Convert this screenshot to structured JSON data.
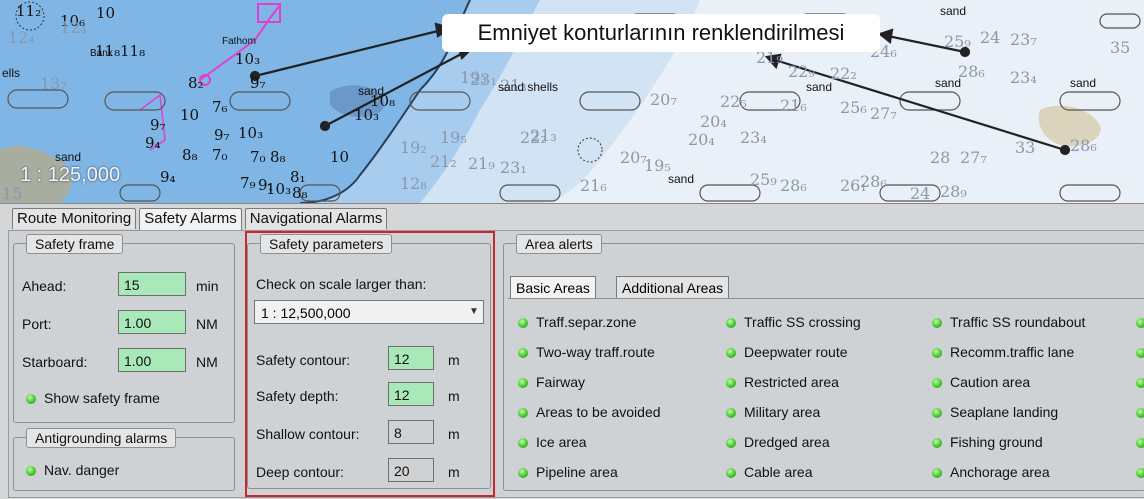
{
  "chart": {
    "callout_text": "Emniyet konturlarının renklendirilmesi",
    "scale": "1 : 125,000",
    "nature_labels": [
      "sand shells",
      "sand",
      "sand",
      "sand",
      "sand",
      "sand",
      "sand",
      "sand",
      "Bank",
      "Fathom",
      "ells"
    ],
    "depths_dark": [
      "11₂",
      "10₆",
      "11₈",
      "10",
      "8₂",
      "9₇",
      "10₃",
      "9₄",
      "8₈",
      "7₆",
      "7₀",
      "9₇",
      "10",
      "9₇",
      "10₃",
      "10₃",
      "8₈",
      "7₀",
      "9₄",
      "7₉",
      "9₁",
      "10₃",
      "8₁",
      "8₈",
      "10",
      "10₈",
      "11₈"
    ],
    "depths_light": [
      "19₃",
      "21₃",
      "23₁",
      "21₉",
      "22₉",
      "22₂",
      "24₆",
      "25₉",
      "24",
      "23₇",
      "35",
      "28₆",
      "23₄",
      "19₅",
      "21₃",
      "20₇",
      "20₄",
      "20₄",
      "23₄",
      "21₆",
      "22₅",
      "25₆",
      "27₇",
      "28",
      "27₇",
      "33",
      "28₆",
      "21₆",
      "20₇",
      "19₅",
      "25₉",
      "28₆",
      "26₁",
      "28₆",
      "28₉",
      "24",
      "19₂",
      "21₂",
      "21₉",
      "23₁",
      "22₂",
      "12₄",
      "13₇",
      "12₄",
      "15",
      "12₈"
    ]
  },
  "tabs": [
    "Route Monitoring",
    "Safety Alarms",
    "Navigational Alarms"
  ],
  "active_tab": "Safety Alarms",
  "safety_frame": {
    "title": "Safety frame",
    "ahead_label": "Ahead:",
    "ahead_value": "15",
    "ahead_unit": "min",
    "port_label": "Port:",
    "port_value": "1.00",
    "port_unit": "NM",
    "starboard_label": "Starboard:",
    "starboard_value": "1.00",
    "starboard_unit": "NM",
    "show_label": "Show safety frame"
  },
  "antigrounding": {
    "title": "Antigrounding alarms",
    "nav_danger": "Nav. danger"
  },
  "safety_params": {
    "title": "Safety parameters",
    "check_label": "Check on scale larger than:",
    "scale_value": "1 : 12,500,000",
    "safety_contour_label": "Safety contour:",
    "safety_contour_value": "12",
    "safety_contour_unit": "m",
    "safety_depth_label": "Safety depth:",
    "safety_depth_value": "12",
    "safety_depth_unit": "m",
    "shallow_contour_label": "Shallow contour:",
    "shallow_contour_value": "8",
    "shallow_contour_unit": "m",
    "deep_contour_label": "Deep contour:",
    "deep_contour_value": "20",
    "deep_contour_unit": "m"
  },
  "area_alerts": {
    "title": "Area alerts",
    "subtabs": [
      "Basic Areas",
      "Additional Areas"
    ],
    "col1": [
      "Traff.separ.zone",
      "Two-way traff.route",
      "Fairway",
      "Areas to be avoided",
      "Ice area",
      "Pipeline area"
    ],
    "col2": [
      "Traffic SS crossing",
      "Deepwater route",
      "Restricted area",
      "Military area",
      "Dredged area",
      "Cable area"
    ],
    "col3": [
      "Traffic SS roundabout",
      "Recomm.traffic lane",
      "Caution area",
      "Seaplane landing",
      "Fishing ground",
      "Anchorage area"
    ]
  },
  "colors": {
    "deep_water": "#eef3f8",
    "shallow_dark": "#7cb4e4",
    "shallow_mid": "#a9cdee",
    "land": "#c8a864",
    "field_green": "#a9e8b9",
    "highlight_red": "#c9272f",
    "indicator_green": "#3fbf28"
  }
}
